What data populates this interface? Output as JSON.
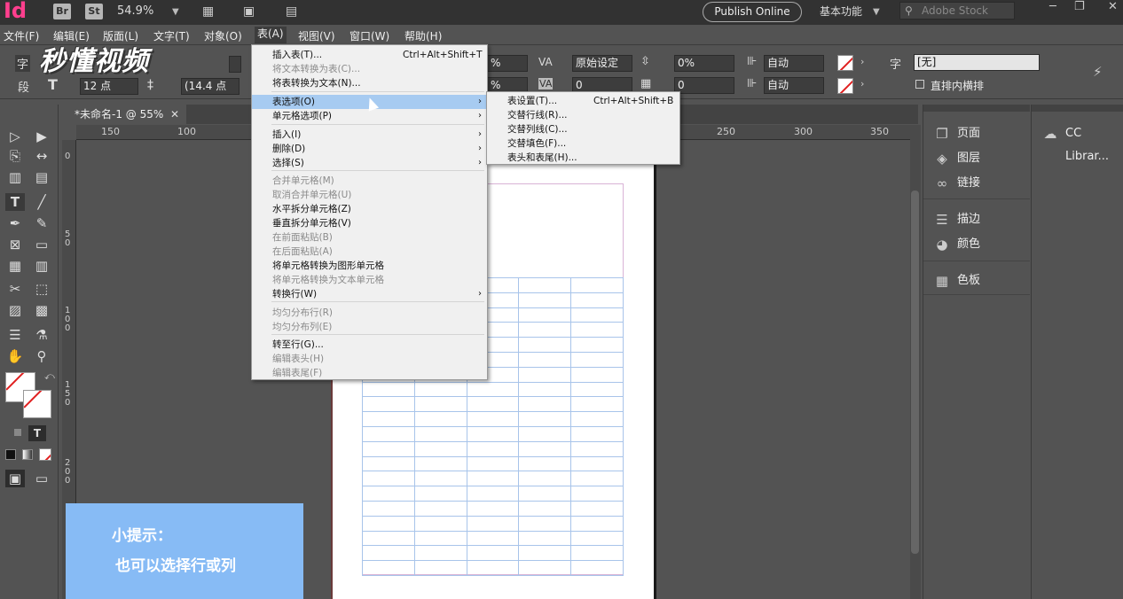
{
  "appbar": {
    "app_logo": "Id",
    "bridge": "Br",
    "stock_icon": "St",
    "zoom": "54.9%",
    "publish": "Publish Online",
    "workspace": "基本功能",
    "search_placeholder": "Adobe Stock"
  },
  "menubar": {
    "items": [
      "文件(F)",
      "编辑(E)",
      "版面(L)",
      "文字(T)",
      "对象(O)",
      "表(A)",
      "视图(V)",
      "窗口(W)",
      "帮助(H)"
    ]
  },
  "control": {
    "size_label": "12 点",
    "leading": "(14.4 点",
    "pct1": "%",
    "pct2": "%",
    "kerning": "原始设定",
    "tracking_val": "0",
    "pct_val": "0%",
    "baseline": "0",
    "auto1": "自动",
    "auto2": "自动",
    "style": "[无]",
    "vertical": "直排内横排",
    "char_icon": "字",
    "para_icon": "段"
  },
  "watermark": "秒懂视频",
  "document": {
    "tab": "*未命名-1 @ 55%"
  },
  "ruler": {
    "h": [
      "150",
      "100",
      "250",
      "300",
      "350"
    ],
    "v": [
      "0",
      "5 0",
      "1 0 0",
      "1 5 0",
      "2 0 0"
    ]
  },
  "panels": {
    "col1": [
      "页面",
      "图层",
      "链接",
      "描边",
      "颜色",
      "色板"
    ],
    "col2": [
      "CC Librar..."
    ]
  },
  "tip": {
    "line1": "小提示：",
    "line2": "也可以选择行或列"
  },
  "table_menu": {
    "items": [
      {
        "label": "插入表(T)...",
        "shortcut": "Ctrl+Alt+Shift+T",
        "disabled": false
      },
      {
        "label": "将文本转换为表(C)...",
        "disabled": true
      },
      {
        "label": "将表转换为文本(N)...",
        "disabled": false
      },
      {
        "label": "表选项(O)",
        "submenu": true,
        "disabled": false,
        "highlighted": true
      },
      {
        "label": "单元格选项(P)",
        "submenu": true,
        "disabled": false
      },
      {
        "label": "插入(I)",
        "submenu": true,
        "disabled": false
      },
      {
        "label": "删除(D)",
        "submenu": true,
        "disabled": false
      },
      {
        "label": "选择(S)",
        "submenu": true,
        "disabled": false
      },
      {
        "label": "合并单元格(M)",
        "disabled": true
      },
      {
        "label": "取消合并单元格(U)",
        "disabled": true
      },
      {
        "label": "水平拆分单元格(Z)",
        "disabled": false
      },
      {
        "label": "垂直拆分单元格(V)",
        "disabled": false
      },
      {
        "label": "在前面粘贴(B)",
        "disabled": true
      },
      {
        "label": "在后面粘贴(A)",
        "disabled": true
      },
      {
        "label": "将单元格转换为图形单元格",
        "disabled": false
      },
      {
        "label": "将单元格转换为文本单元格",
        "disabled": true
      },
      {
        "label": "转换行(W)",
        "submenu": true,
        "disabled": false
      },
      {
        "label": "均匀分布行(R)",
        "disabled": true
      },
      {
        "label": "均匀分布列(E)",
        "disabled": true
      },
      {
        "label": "转至行(G)...",
        "disabled": false
      },
      {
        "label": "编辑表头(H)",
        "disabled": true
      },
      {
        "label": "编辑表尾(F)",
        "disabled": true
      }
    ]
  },
  "sub_menu": {
    "items": [
      {
        "label": "表设置(T)...",
        "shortcut": "Ctrl+Alt+Shift+B"
      },
      {
        "label": "交替行线(R)..."
      },
      {
        "label": "交替列线(C)..."
      },
      {
        "label": "交替填色(F)..."
      },
      {
        "label": "表头和表尾(H)..."
      }
    ]
  }
}
